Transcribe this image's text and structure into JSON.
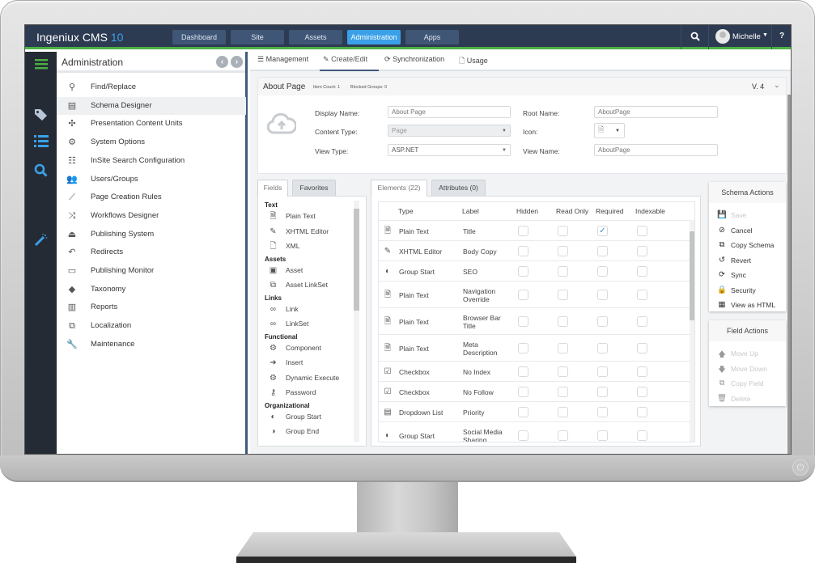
{
  "app": {
    "name": "Ingeniux CMS",
    "version": "10"
  },
  "topnav": {
    "items": [
      {
        "label": "Dashboard",
        "active": false
      },
      {
        "label": "Site",
        "active": false
      },
      {
        "label": "Assets",
        "active": false
      },
      {
        "label": "Administration",
        "active": true
      },
      {
        "label": "Apps",
        "active": false
      }
    ],
    "search_icon": "search-icon",
    "user": {
      "name": "Michelle",
      "dropdown_icon": "caret-down-icon"
    },
    "help_label": "?"
  },
  "rail": {
    "icons": [
      "hamburger-icon",
      "tags-icon",
      "list-icon",
      "search-icon",
      "magic-wand-icon"
    ],
    "colors": {
      "hamburger": "#4bb043",
      "accent": "#3aa0e8"
    }
  },
  "sidebar": {
    "title": "Administration",
    "prev_label": "‹",
    "next_label": "›",
    "items": [
      {
        "label": "Find/Replace",
        "icon": "search-icon",
        "selected": false
      },
      {
        "label": "Schema Designer",
        "icon": "schema-icon",
        "selected": true
      },
      {
        "label": "Presentation Content Units",
        "icon": "puzzle-icon",
        "selected": false
      },
      {
        "label": "System Options",
        "icon": "cogs-icon",
        "selected": false
      },
      {
        "label": "InSite Search Configuration",
        "icon": "search-config-icon",
        "selected": false
      },
      {
        "label": "Users/Groups",
        "icon": "users-icon",
        "selected": false
      },
      {
        "label": "Page Creation Rules",
        "icon": "wand-icon",
        "selected": false
      },
      {
        "label": "Workflows Designer",
        "icon": "shuffle-icon",
        "selected": false
      },
      {
        "label": "Publishing System",
        "icon": "publish-icon",
        "selected": false
      },
      {
        "label": "Redirects",
        "icon": "redirect-icon",
        "selected": false
      },
      {
        "label": "Publishing Monitor",
        "icon": "monitor-icon",
        "selected": false
      },
      {
        "label": "Taxonomy",
        "icon": "tags-icon",
        "selected": false
      },
      {
        "label": "Reports",
        "icon": "reports-icon",
        "selected": false
      },
      {
        "label": "Localization",
        "icon": "localization-icon",
        "selected": false
      },
      {
        "label": "Maintenance",
        "icon": "wrench-icon",
        "selected": false
      }
    ]
  },
  "tabs": [
    {
      "label": "Management",
      "icon": "list-icon",
      "active": false
    },
    {
      "label": "Create/Edit",
      "icon": "edit-icon",
      "active": true
    },
    {
      "label": "Synchronization",
      "icon": "sync-icon",
      "active": false
    },
    {
      "label": "Usage",
      "icon": "document-icon",
      "active": false
    }
  ],
  "schema": {
    "title": "About Page",
    "item_count": "Item Count: 1",
    "blocked_groups": "Blocked Groups: 0",
    "version": "V. 4",
    "fields": {
      "display_name_label": "Display Name:",
      "display_name_value": "About Page",
      "content_type_label": "Content Type:",
      "content_type_value": "Page",
      "view_type_label": "View Type:",
      "view_type_value": "ASP.NET",
      "root_name_label": "Root Name:",
      "root_name_value": "AboutPage",
      "icon_label": "Icon:",
      "view_name_label": "View Name:",
      "view_name_value": "AboutPage"
    }
  },
  "fields_panel": {
    "tabs": [
      {
        "label": "Fields",
        "active": true
      },
      {
        "label": "Favorites",
        "active": false
      }
    ],
    "groups": [
      {
        "name": "Text",
        "items": [
          {
            "label": "Plain Text",
            "icon": "file-text-icon"
          },
          {
            "label": "XHTML Editor",
            "icon": "edit-icon"
          },
          {
            "label": "XML",
            "icon": "xml-file-icon"
          }
        ]
      },
      {
        "name": "Assets",
        "items": [
          {
            "label": "Asset",
            "icon": "image-icon"
          },
          {
            "label": "Asset LinkSet",
            "icon": "copy-icon"
          }
        ]
      },
      {
        "name": "Links",
        "items": [
          {
            "label": "Link",
            "icon": "link-icon"
          },
          {
            "label": "LinkSet",
            "icon": "link-icon"
          }
        ]
      },
      {
        "name": "Functional",
        "items": [
          {
            "label": "Component",
            "icon": "cog-icon"
          },
          {
            "label": "Insert",
            "icon": "insert-icon"
          },
          {
            "label": "Dynamic Execute",
            "icon": "cog-icon"
          },
          {
            "label": "Password",
            "icon": "key-icon"
          }
        ]
      },
      {
        "name": "Organizational",
        "items": [
          {
            "label": "Group Start",
            "icon": "group-start-icon"
          },
          {
            "label": "Group End",
            "icon": "group-end-icon"
          }
        ]
      }
    ]
  },
  "elements_panel": {
    "tabs": [
      {
        "label": "Elements (22)",
        "active": true
      },
      {
        "label": "Attributes (0)",
        "active": false
      }
    ],
    "columns": [
      "Type",
      "Label",
      "Hidden",
      "Read Only",
      "Required",
      "Indexable"
    ],
    "rows": [
      {
        "type": "Plain Text",
        "icon": "file-text-icon",
        "label": "Title",
        "hidden": false,
        "read_only": false,
        "required": true,
        "indexable": false
      },
      {
        "type": "XHTML Editor",
        "icon": "edit-icon",
        "label": "Body Copy",
        "hidden": false,
        "read_only": false,
        "required": false,
        "indexable": false
      },
      {
        "type": "Group Start",
        "icon": "group-start-icon",
        "label": "SEO",
        "hidden": false,
        "read_only": false,
        "required": false,
        "indexable": false
      },
      {
        "type": "Plain Text",
        "icon": "file-text-icon",
        "label": "Navigation Override",
        "hidden": false,
        "read_only": false,
        "required": false,
        "indexable": false
      },
      {
        "type": "Plain Text",
        "icon": "file-text-icon",
        "label": "Browser Bar Title",
        "hidden": false,
        "read_only": false,
        "required": false,
        "indexable": false
      },
      {
        "type": "Plain Text",
        "icon": "file-text-icon",
        "label": "Meta Description",
        "hidden": false,
        "read_only": false,
        "required": false,
        "indexable": false
      },
      {
        "type": "Checkbox",
        "icon": "checkbox-icon",
        "label": "No Index",
        "hidden": false,
        "read_only": false,
        "required": false,
        "indexable": false
      },
      {
        "type": "Checkbox",
        "icon": "checkbox-icon",
        "label": "No Follow",
        "hidden": false,
        "read_only": false,
        "required": false,
        "indexable": false
      },
      {
        "type": "Dropdown List",
        "icon": "dropdown-icon",
        "label": "Priority",
        "hidden": false,
        "read_only": false,
        "required": false,
        "indexable": false
      },
      {
        "type": "Group Start",
        "icon": "group-start-icon",
        "label": "Social Media Sharing",
        "hidden": false,
        "read_only": false,
        "required": false,
        "indexable": false
      }
    ]
  },
  "schema_actions": {
    "title": "Schema Actions",
    "items": [
      {
        "label": "Save",
        "icon": "save-icon",
        "enabled": false
      },
      {
        "label": "Cancel",
        "icon": "ban-icon",
        "enabled": true
      },
      {
        "label": "Copy Schema",
        "icon": "copy-icon",
        "enabled": true
      },
      {
        "label": "Revert",
        "icon": "undo-icon",
        "enabled": true
      },
      {
        "label": "Sync",
        "icon": "sync-icon",
        "enabled": true
      },
      {
        "label": "Security",
        "icon": "lock-icon",
        "enabled": true
      },
      {
        "label": "View as HTML",
        "icon": "table-icon",
        "enabled": true
      }
    ]
  },
  "field_actions": {
    "title": "Field Actions",
    "items": [
      {
        "label": "Move Up",
        "icon": "arrow-up-icon",
        "enabled": false
      },
      {
        "label": "Move Down",
        "icon": "arrow-down-icon",
        "enabled": false
      },
      {
        "label": "Copy Field",
        "icon": "copy-icon",
        "enabled": false
      },
      {
        "label": "Delete",
        "icon": "trash-icon",
        "enabled": false
      }
    ]
  }
}
